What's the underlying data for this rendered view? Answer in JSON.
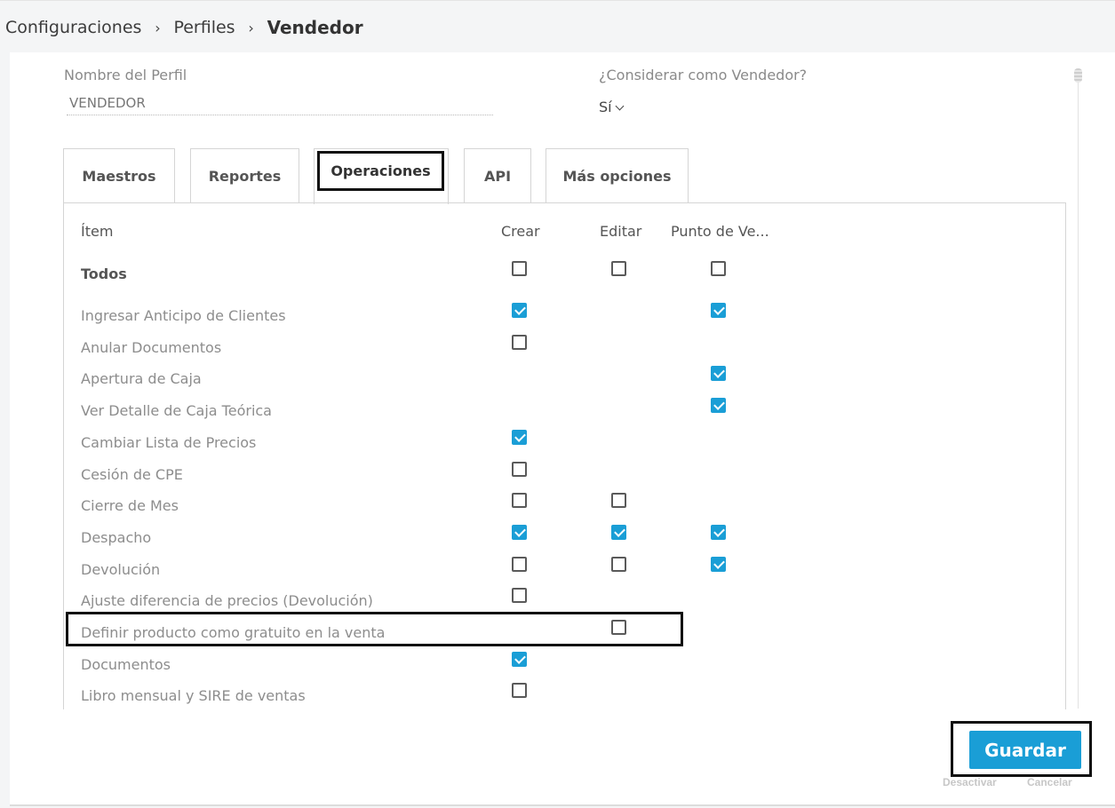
{
  "breadcrumb": {
    "items": [
      "Configuraciones",
      "Perfiles"
    ],
    "separator": "›",
    "current": "Vendedor"
  },
  "form": {
    "name_label": "Nombre del Perfil",
    "name_value": "VENDEDOR",
    "seller_label": "¿Considerar como Vendedor?",
    "seller_value": "Sí"
  },
  "tabs": [
    {
      "label": "Maestros",
      "active": false
    },
    {
      "label": "Reportes",
      "active": false
    },
    {
      "label": "Operaciones",
      "active": true
    },
    {
      "label": "API",
      "active": false
    },
    {
      "label": "Más opciones",
      "active": false
    }
  ],
  "table": {
    "headers": {
      "item": "Ítem",
      "crear": "Crear",
      "editar": "Editar",
      "punto": "Punto de Ve..."
    },
    "all_label": "Todos",
    "rows": [
      {
        "label": "Ingresar Anticipo de Clientes",
        "crear": true,
        "editar": null,
        "punto": true
      },
      {
        "label": "Anular Documentos",
        "crear": false,
        "editar": null,
        "punto": null
      },
      {
        "label": "Apertura de Caja",
        "crear": null,
        "editar": null,
        "punto": true
      },
      {
        "label": "Ver Detalle de Caja Teórica",
        "crear": null,
        "editar": null,
        "punto": true
      },
      {
        "label": "Cambiar Lista de Precios",
        "crear": true,
        "editar": null,
        "punto": null
      },
      {
        "label": "Cesión de CPE",
        "crear": false,
        "editar": null,
        "punto": null
      },
      {
        "label": "Cierre de Mes",
        "crear": false,
        "editar": false,
        "punto": null
      },
      {
        "label": "Despacho",
        "crear": true,
        "editar": true,
        "punto": true
      },
      {
        "label": "Devolución",
        "crear": false,
        "editar": false,
        "punto": true
      },
      {
        "label": "Ajuste diferencia de precios (Devolución)",
        "crear": false,
        "editar": null,
        "punto": null
      },
      {
        "label": "Definir producto como gratuito en la venta",
        "crear": null,
        "editar": false,
        "punto": null
      },
      {
        "label": "Documentos",
        "crear": true,
        "editar": null,
        "punto": null
      },
      {
        "label": "Libro mensual y SIRE de ventas",
        "crear": false,
        "editar": null,
        "punto": null
      }
    ]
  },
  "actions": {
    "save": "Guardar",
    "deactivate": "Desactivar",
    "cancel": "Cancelar"
  },
  "colors": {
    "accent": "#1a9ed6",
    "highlight_border": "#111111"
  }
}
